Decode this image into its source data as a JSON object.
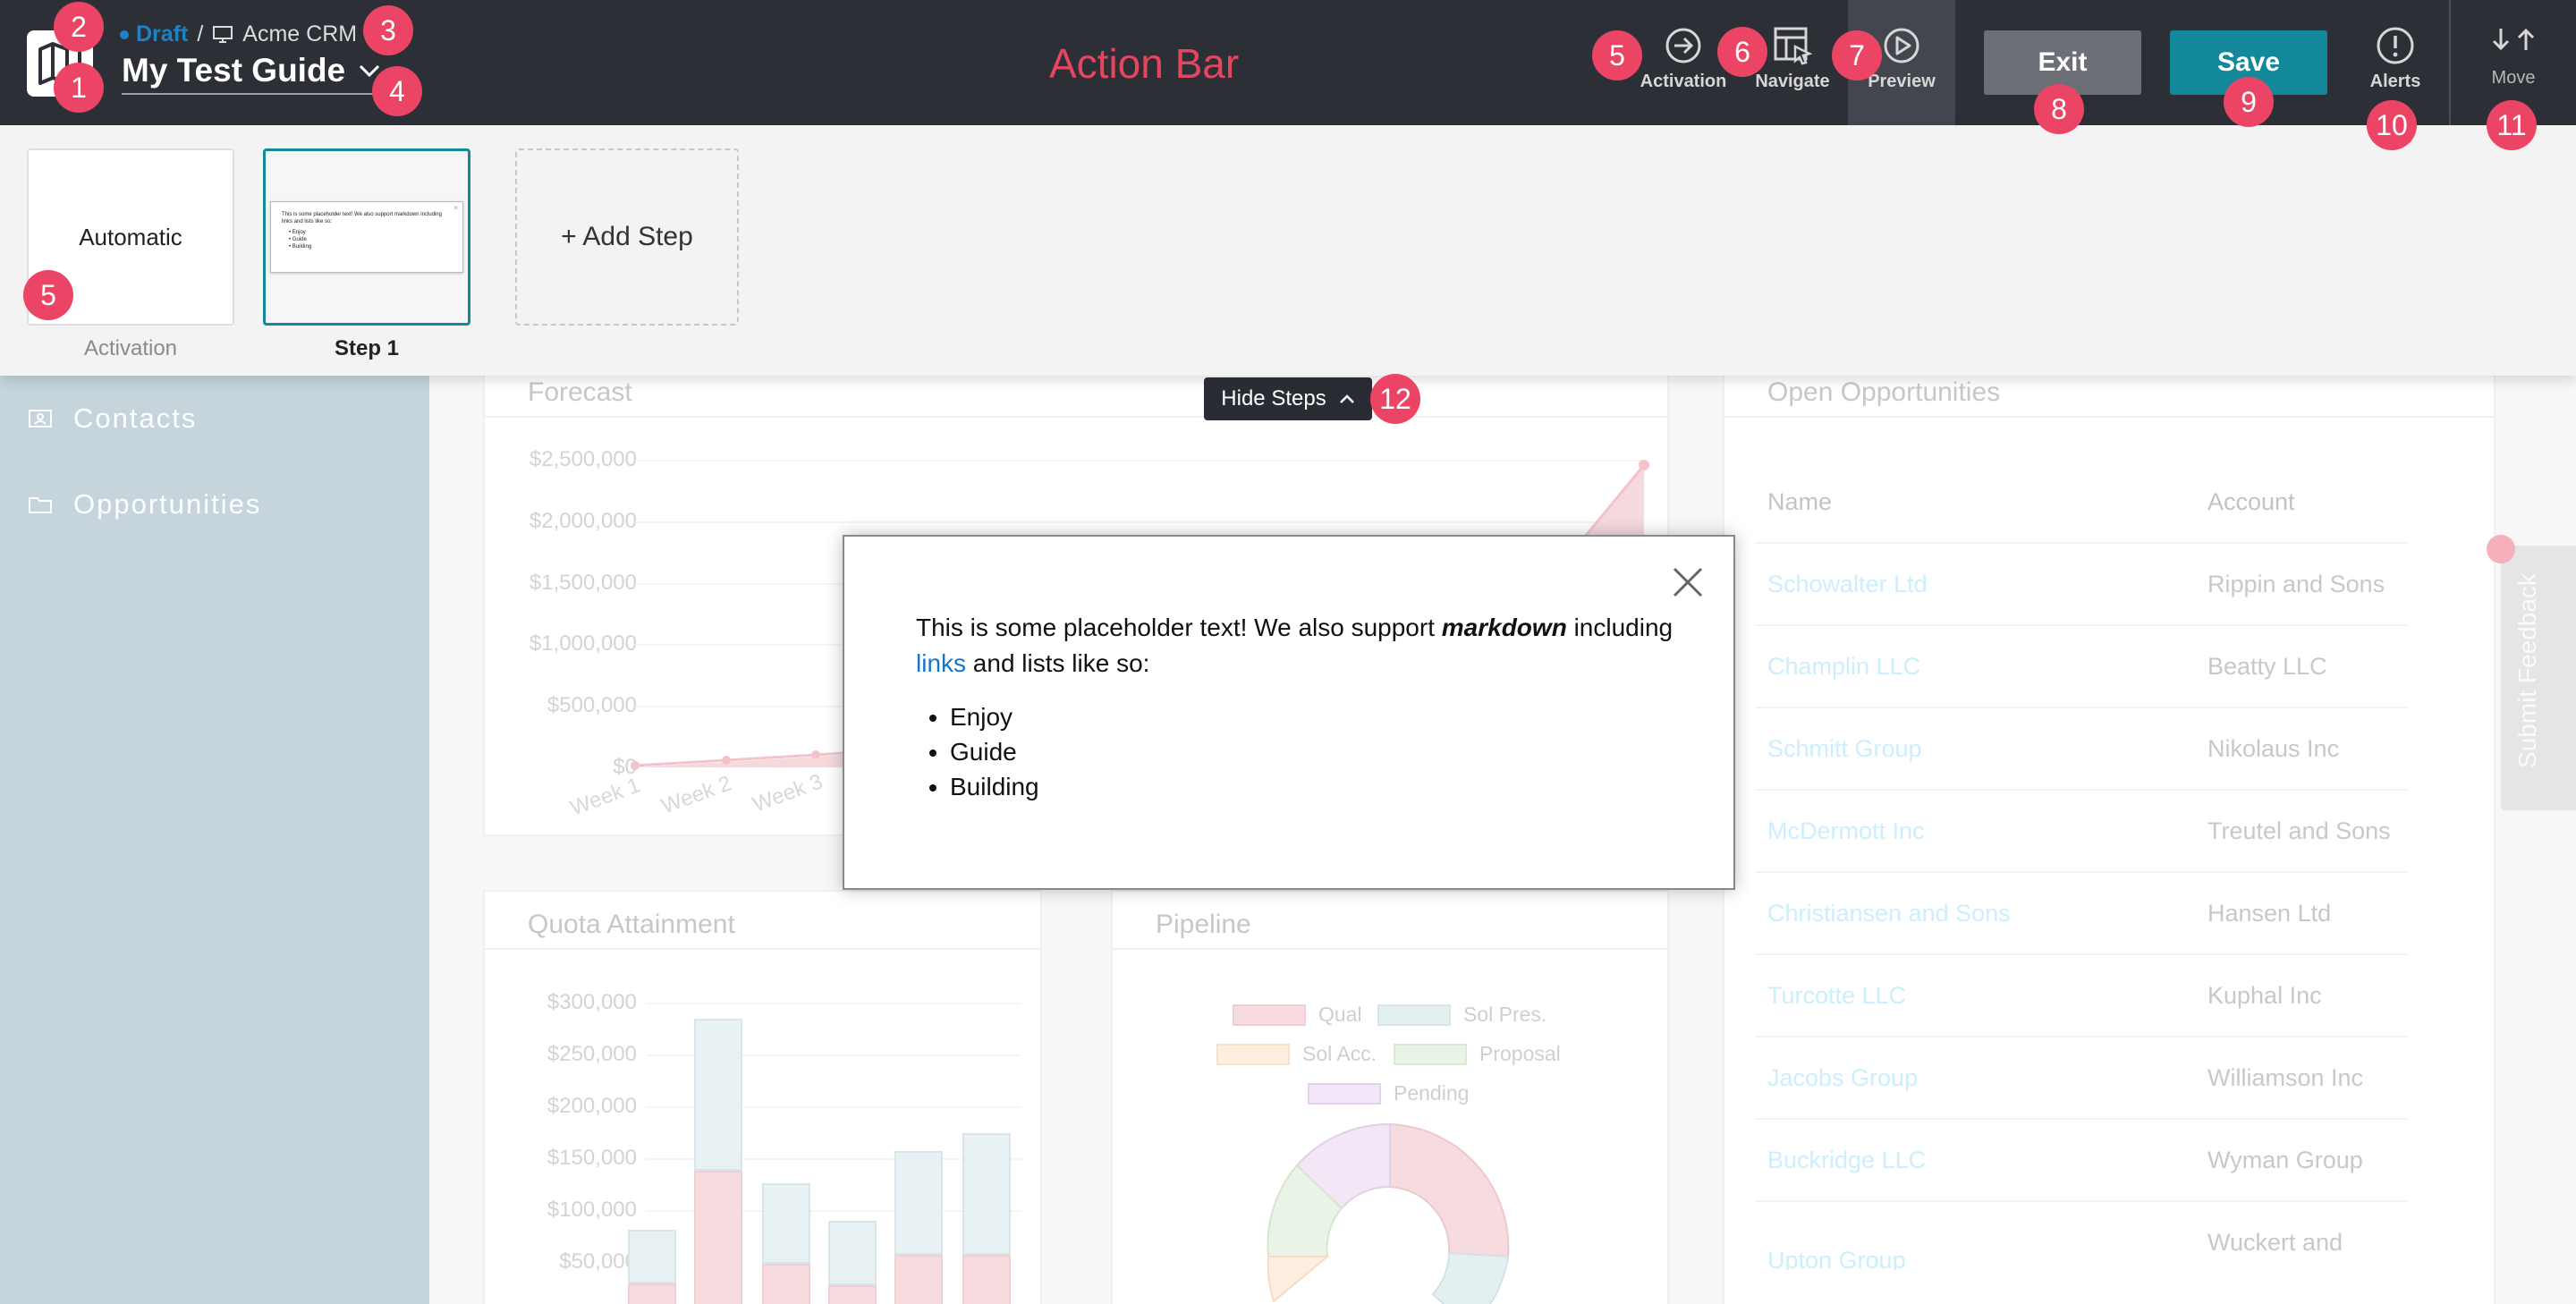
{
  "topbar": {
    "status": "Draft",
    "app_name": "Acme CRM",
    "guide_title": "My Test Guide",
    "center_label": "Action Bar",
    "buttons": {
      "activation": "Activation",
      "navigate": "Navigate",
      "preview": "Preview",
      "exit": "Exit",
      "save": "Save",
      "alerts": "Alerts",
      "move": "Move"
    }
  },
  "steps_panel": {
    "activation_card": "Automatic",
    "activation_caption": "Activation",
    "step1_caption": "Step 1",
    "add_step": "+ Add Step",
    "step1_thumb": {
      "line1": "This is some placeholder text! We also support markdown including",
      "line2": "links and lists like so:",
      "items": [
        "Enjoy",
        "Guide",
        "Building"
      ]
    },
    "hide_steps": "Hide Steps"
  },
  "modal": {
    "text_before": "This is some placeholder text!  We also support ",
    "emphasis": "markdown",
    "text_after": " including ",
    "link": "links",
    "text_end": " and lists like so:",
    "items": [
      "Enjoy",
      "Guide",
      "Building"
    ]
  },
  "badges": [
    "1",
    "2",
    "3",
    "4",
    "5",
    "6",
    "7",
    "8",
    "9",
    "10",
    "11",
    "5",
    "12"
  ],
  "app": {
    "sidebar": [
      {
        "label": "Contacts",
        "icon": "contacts-icon"
      },
      {
        "label": "Opportunities",
        "icon": "folder-icon"
      }
    ],
    "forecast": {
      "title": "Forecast",
      "y_ticks": [
        "$2,500,000",
        "$2,000,000",
        "$1,500,000",
        "$1,000,000",
        "$500,000",
        "$0"
      ],
      "x_ticks": [
        "Week 1",
        "Week 2",
        "Week 3"
      ]
    },
    "quota": {
      "title": "Quota Attainment",
      "y_ticks": [
        "$300,000",
        "$250,000",
        "$200,000",
        "$150,000",
        "$100,000",
        "$50,000"
      ]
    },
    "pipeline": {
      "title": "Pipeline",
      "legend": [
        "Qual",
        "Sol Pres.",
        "Sol Acc.",
        "Proposal",
        "Pending"
      ]
    },
    "open_opps": {
      "title": "Open Opportunities",
      "col_name": "Name",
      "col_account": "Account",
      "rows": [
        {
          "name": "Schowalter Ltd",
          "account": "Rippin and Sons"
        },
        {
          "name": "Champlin LLC",
          "account": "Beatty LLC"
        },
        {
          "name": "Schmitt Group",
          "account": "Nikolaus Inc"
        },
        {
          "name": "McDermott Inc",
          "account": "Treutel and Sons"
        },
        {
          "name": "Christiansen and Sons",
          "account": "Hansen Ltd"
        },
        {
          "name": "Turcotte LLC",
          "account": "Kuphal Inc"
        },
        {
          "name": "Jacobs Group",
          "account": "Williamson Inc"
        },
        {
          "name": "Buckridge LLC",
          "account": "Wyman Group"
        },
        {
          "name": "Upton Group",
          "account": "Wuckert and"
        }
      ]
    },
    "feedback_tab": "Submit Feedback"
  },
  "colors": {
    "topbar": "#2d2f36",
    "accent_save": "#13889b",
    "badge": "#ec4464",
    "draft": "#1b82c4"
  }
}
